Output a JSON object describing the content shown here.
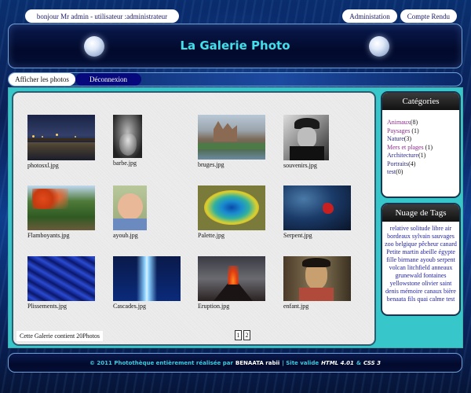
{
  "top": {
    "greeting": "bonjour Mr admin - utilisateur :administrateur",
    "nav": [
      "Administation",
      "Compte Rendu"
    ]
  },
  "header": {
    "title": "La Galerie Photo"
  },
  "tabs": {
    "photos": "Afficher les photos",
    "logout": "Déconnexion"
  },
  "gallery": {
    "items": [
      {
        "caption": "photosxl.jpg",
        "icon": "pier-sunset-photo"
      },
      {
        "caption": "barbe.jpg",
        "icon": "bearded-man-photo"
      },
      {
        "caption": "bruges.jpg",
        "icon": "bruges-canal-photo"
      },
      {
        "caption": "souvenirs.jpg",
        "icon": "old-man-portrait-photo"
      },
      {
        "caption": "Flamboyants.jpg",
        "icon": "flame-tree-photo"
      },
      {
        "caption": "ayoub.jpg",
        "icon": "baby-photo"
      },
      {
        "caption": "Palette.jpg",
        "icon": "hot-spring-photo"
      },
      {
        "caption": "Serpent.jpg",
        "icon": "snake-photo"
      },
      {
        "caption": "Plissements.jpg",
        "icon": "blue-silk-photo"
      },
      {
        "caption": "Cascades.jpg",
        "icon": "blue-waterfall-photo"
      },
      {
        "caption": "Eruption.jpg",
        "icon": "volcano-eruption-photo"
      },
      {
        "caption": "enfant.jpg",
        "icon": "child-portrait-photo"
      }
    ],
    "count_text": "Cette Galerie contient 20Photos",
    "pages": [
      "1",
      "2"
    ]
  },
  "categories": {
    "title": "Catégories",
    "items": [
      {
        "name": "Animaux",
        "count": "(8)"
      },
      {
        "name": "Paysages",
        "count": " (1)"
      },
      {
        "name": "Nature",
        "count": "(3)"
      },
      {
        "name": "Mers et plages",
        "count": " (1)"
      },
      {
        "name": "Architecture",
        "count": "(1)"
      },
      {
        "name": "Portraits",
        "count": "(4)"
      },
      {
        "name": "test",
        "count": "(0)"
      }
    ]
  },
  "tags": {
    "title": "Nuage de Tags",
    "words": [
      "relative",
      "solitude",
      "libre",
      "air",
      "bordeaux",
      "sylvain",
      "sauvages",
      "zoo",
      "belgique",
      "pêcheur",
      "canard",
      "Petite",
      "martin",
      "abeille",
      "égypte",
      "fille",
      "birmane",
      "ayoub",
      "serpent",
      "volcan",
      "litchfield",
      "anneaux",
      "grunewald",
      "fontaines",
      "yellowstone",
      "olivier",
      "saint",
      "denis",
      "mémoire",
      "canaux",
      "bière",
      "benaata",
      "fils",
      "quai",
      "calme",
      "test"
    ]
  },
  "footer": {
    "prefix": "© 2011 Photothèque entièrement réalisée par",
    "author": "BENAATA rabii",
    "sep": "| Site valide",
    "html": "HTML 4.01",
    "amp": "&",
    "css": "CSS 3"
  },
  "colors": {
    "accent_cyan": "#41e0ea",
    "main_bg": "#37c6c9",
    "tab_active": "#08087d"
  }
}
